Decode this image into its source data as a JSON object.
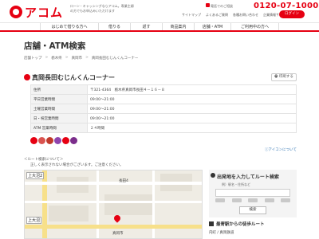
{
  "header": {
    "brand": "アコム",
    "tagline": "ローン・キャッシングならアコム。専業主婦の方でもお申込みいただけます",
    "phone_label": "電話でのご相談",
    "phone_number": "0120-07-1000",
    "top_links": [
      "サイトマップ",
      "よくあるご質問",
      "各種お問い合わせ",
      "企業情報サイト"
    ],
    "login_label": "ログイン"
  },
  "nav": {
    "items": [
      "はじめて借りる方へ",
      "借りる",
      "返す",
      "商品案内",
      "店舗・ATM",
      "ご利用中の方へ"
    ]
  },
  "page": {
    "title": "店舗・ATM検索",
    "breadcrumb": [
      "店舗トップ",
      "栃木県",
      "真岡市",
      "真岡長田むじんくんコーナー"
    ]
  },
  "store": {
    "name": "真岡長田むじんくんコーナー",
    "print_label": "印刷する",
    "rows": [
      {
        "label": "住所",
        "value": "〒321-4364　栃木県真岡市長田４－１６－８"
      },
      {
        "label": "平日営業時間",
        "value": "09:00～21:00"
      },
      {
        "label": "土曜営業時間",
        "value": "09:00～21:00"
      },
      {
        "label": "日・祝営業時間",
        "value": "09:00～21:00"
      },
      {
        "label": "ATM 営業時間",
        "value": "２４時間"
      }
    ],
    "service_icons": [
      {
        "name": "service-icon-1",
        "color": "#e60012"
      },
      {
        "name": "service-icon-2",
        "color": "#d9534f"
      },
      {
        "name": "service-icon-3",
        "color": "#c0392b"
      },
      {
        "name": "service-icon-4",
        "color": "#8e44ad"
      },
      {
        "name": "service-icon-5",
        "color": "#e60012"
      },
      {
        "name": "service-icon-6",
        "color": "#7b2d8b"
      }
    ],
    "icon_note": "アイコンについて"
  },
  "route_note": {
    "heading": "＜ルート検索について＞",
    "body": "正しく表示されない場合がございます。ご注意ください。"
  },
  "map": {
    "labels": [
      "上大沼2",
      "長田4",
      "上大沼",
      "真岡市"
    ]
  },
  "route_box": {
    "title": "出発地を入力してルート検索",
    "hint": "例）駅名・住所など",
    "search_label": "検索"
  },
  "nearest": {
    "title": "最寄駅からの徒歩ルート",
    "line": "内町 / 真岡鉄道"
  },
  "colors": {
    "accent": "#e60012"
  }
}
